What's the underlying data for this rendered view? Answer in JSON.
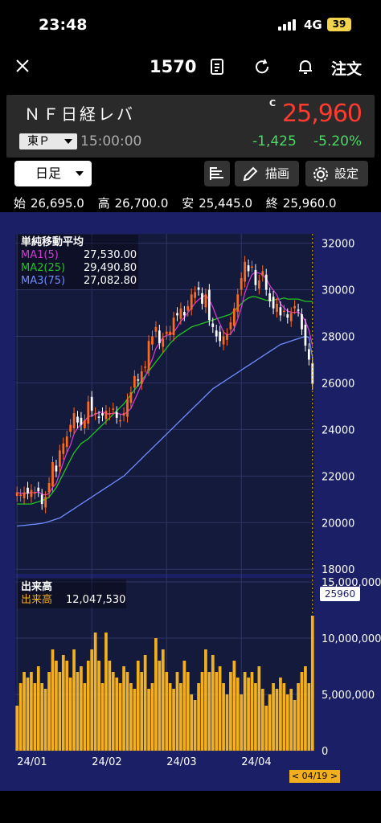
{
  "status": {
    "time": "23:48",
    "network": "4G",
    "battery": "39"
  },
  "nav": {
    "code": "1570",
    "order_label": "注文"
  },
  "quote": {
    "name": "ＮＦ日経レバ",
    "market": "東Ｐ",
    "time": "15:00:00",
    "c_mark": "C",
    "price": "25,960",
    "change": "-1,425",
    "change_pct": "-5.20%"
  },
  "toolbar": {
    "period": "日足",
    "draw_label": "描画",
    "settings_label": "設定"
  },
  "ohlc": {
    "open_label": "始",
    "open": "26,695.0",
    "high_label": "高",
    "high": "26,700.0",
    "low_label": "安",
    "low": "25,445.0",
    "close_label": "終",
    "close": "25,960.0"
  },
  "legend": {
    "title": "単純移動平均",
    "ma1_label": "MA1(5)",
    "ma1_value": "27,530.00",
    "ma2_label": "MA2(25)",
    "ma2_value": "29,490.80",
    "ma3_label": "MA3(75)",
    "ma3_value": "27,082.80"
  },
  "volume_legend": {
    "title": "出来高",
    "label": "出来高",
    "value": "12,047,530"
  },
  "current_price_tag": "25960",
  "date_flag": "< 04/19 >",
  "colors": {
    "up": "#ff6a1a",
    "down": "#ffffff",
    "ma1": "#d13bd1",
    "ma2": "#21c421",
    "ma3": "#6f8cff",
    "volume": "#f2b01e",
    "price": "#ff3b30",
    "change": "#4cd964"
  },
  "chart_data": {
    "type": "candlestick",
    "price_axis_ticks": [
      "32000",
      "30000",
      "28000",
      "26000",
      "24000",
      "22000",
      "20000",
      "18000"
    ],
    "volume_axis_ticks": [
      "15,000,000",
      "10,000,000",
      "5,000,000",
      "0"
    ],
    "x_tick_labels": [
      "24/01",
      "24/02",
      "24/03",
      "24/04"
    ],
    "ylim": [
      17800,
      32400
    ],
    "volume_ylim": [
      0,
      15000000
    ],
    "closes": [
      21300,
      21200,
      21300,
      21250,
      21400,
      21300,
      21350,
      20800,
      21100,
      21700,
      22600,
      22200,
      23100,
      23400,
      23700,
      24200,
      24700,
      24300,
      24200,
      24400,
      25200,
      24800,
      24700,
      24500,
      24600,
      24800,
      24700,
      24900,
      24500,
      24400,
      24700,
      25300,
      25600,
      26300,
      26100,
      26500,
      26700,
      27800,
      28000,
      28400,
      27700,
      27900,
      28200,
      28200,
      28800,
      28900,
      29200,
      28900,
      29300,
      29800,
      29900,
      30000,
      29400,
      29800,
      28700,
      28400,
      28000,
      27800,
      28000,
      28100,
      28600,
      29200,
      29800,
      30500,
      31200,
      30800,
      31000,
      30200,
      30400,
      30800,
      30000,
      29500,
      29200,
      29400,
      28900,
      29100,
      28800,
      29000,
      29300,
      29100,
      28300,
      27600,
      27000,
      25960
    ],
    "ma2": [
      20800,
      20800,
      20800,
      20800,
      20800,
      20850,
      20900,
      20950,
      21000,
      21100,
      21300,
      21500,
      21800,
      22100,
      22400,
      22700,
      23000,
      23200,
      23400,
      23500,
      23600,
      23750,
      23900,
      24050,
      24200,
      24350,
      24500,
      24650,
      24800,
      24950,
      25100,
      25300,
      25500,
      25700,
      25900,
      26100,
      26300,
      26500,
      26700,
      26900,
      27100,
      27300,
      27500,
      27700,
      27850,
      28000,
      28100,
      28200,
      28300,
      28400,
      28450,
      28500,
      28550,
      28600,
      28650,
      28700,
      28750,
      28800,
      28850,
      28900,
      28950,
      29100,
      29250,
      29400,
      29550,
      29650,
      29700,
      29700,
      29650,
      29600,
      29550,
      29550,
      29550,
      29600,
      29600,
      29650,
      29600,
      29600,
      29600,
      29600,
      29550,
      29500,
      29500,
      29490
    ],
    "ma3": [
      19850,
      19870,
      19880,
      19900,
      19920,
      19930,
      19950,
      19970,
      20000,
      20050,
      20100,
      20150,
      20200,
      20300,
      20400,
      20500,
      20600,
      20700,
      20800,
      20900,
      21000,
      21100,
      21200,
      21300,
      21400,
      21500,
      21600,
      21700,
      21800,
      21900,
      22000,
      22150,
      22300,
      22450,
      22600,
      22750,
      22900,
      23050,
      23200,
      23350,
      23500,
      23650,
      23800,
      23950,
      24100,
      24250,
      24400,
      24550,
      24700,
      24850,
      25000,
      25150,
      25300,
      25450,
      25600,
      25750,
      25850,
      25950,
      26050,
      26150,
      26250,
      26350,
      26450,
      26550,
      26650,
      26750,
      26850,
      26950,
      27050,
      27150,
      27250,
      27350,
      27450,
      27550,
      27650,
      27700,
      27750,
      27800,
      27850,
      27900,
      27950,
      28000,
      27950,
      27083
    ],
    "volume_millions": [
      4,
      6,
      7,
      6.5,
      7,
      6,
      7.5,
      6,
      5.5,
      7,
      9,
      8,
      7,
      8.5,
      8,
      6.5,
      9,
      7,
      7.5,
      6,
      8,
      9,
      10.5,
      8,
      6,
      10.5,
      8,
      7,
      6.5,
      6,
      7.5,
      7,
      6,
      5.5,
      8,
      7,
      8.5,
      5.5,
      6,
      10,
      8,
      9,
      7,
      6,
      5.5,
      7,
      6,
      8,
      7,
      5,
      4.5,
      6,
      7,
      9,
      7,
      8.5,
      7,
      7.5,
      6,
      5,
      7,
      8,
      6.5,
      5,
      7,
      6.5,
      7,
      6,
      7.5,
      5.5,
      4,
      5,
      6,
      5.5,
      6.5,
      6,
      5,
      5.5,
      4.5,
      6,
      7,
      7.5,
      6,
      12
    ]
  }
}
